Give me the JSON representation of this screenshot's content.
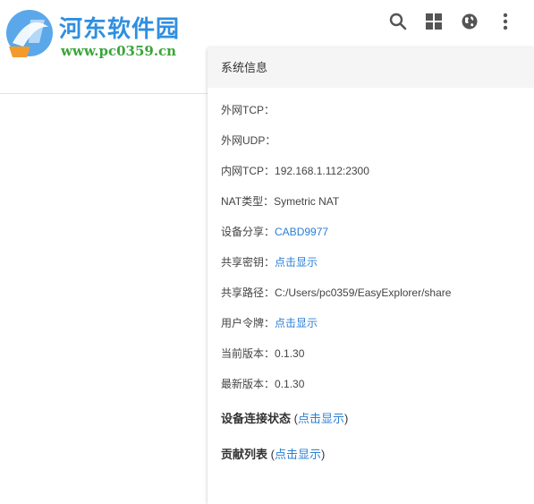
{
  "watermark": {
    "title": "河东软件园",
    "url": "www.pc0359.cn"
  },
  "toolbar": {
    "icons": [
      "search-icon",
      "grid-icon",
      "globe-icon",
      "more-vert-icon"
    ],
    "icon_color": "#555555"
  },
  "panel": {
    "title": "系统信息",
    "rows": [
      {
        "label": "外网TCP：",
        "value": ""
      },
      {
        "label": "外网UDP：",
        "value": ""
      },
      {
        "label": "内网TCP：",
        "value": "192.168.1.112:2300"
      },
      {
        "label": "NAT类型：",
        "value": "Symetric NAT"
      },
      {
        "label": "设备分享：",
        "link": "CABD9977"
      },
      {
        "label": "共享密钥：",
        "link": "点击显示"
      },
      {
        "label": "共享路径：",
        "value": "C:/Users/pc0359/EasyExplorer/share"
      },
      {
        "label": "用户令牌：",
        "link": "点击显示"
      },
      {
        "label": "当前版本：",
        "value": "0.1.30"
      },
      {
        "label": "最新版本：",
        "value": "0.1.30"
      }
    ],
    "sections": [
      {
        "title": "设备连接状态",
        "open": " (",
        "link": "点击显示",
        "close": ")"
      },
      {
        "title": "贡献列表",
        "open": " (",
        "link": "点击显示",
        "close": ")"
      }
    ]
  },
  "colors": {
    "link": "#2a7fd4",
    "logo_blue": "#2f8fe0",
    "logo_green": "#3aa53a",
    "header_bg": "#f5f5f5"
  }
}
